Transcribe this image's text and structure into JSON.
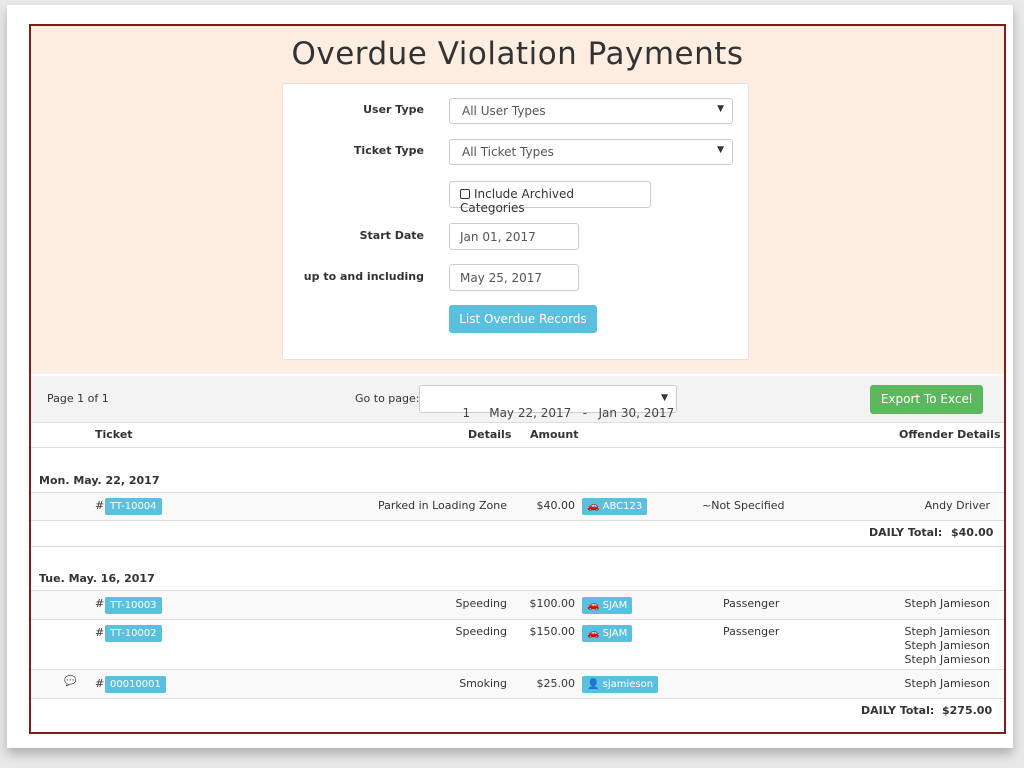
{
  "page": {
    "title": "Overdue Violation Payments"
  },
  "filters": {
    "user_type_label": "User Type",
    "user_type_value": "All User Types",
    "ticket_type_label": "Ticket Type",
    "ticket_type_value": "All Ticket Types",
    "archived_label": "Include Archived Categories",
    "start_date_label": "Start Date",
    "start_date_value": "Jan 01, 2017",
    "end_date_label": "up to and including",
    "end_date_value": "May 25, 2017",
    "submit_label": "List Overdue Records"
  },
  "pager": {
    "page_info": "Page 1 of 1",
    "goto_label": "Go to page:",
    "goto_value": "1     May 22, 2017   -   Jan 30, 2017",
    "export_label": "Export To Excel"
  },
  "columns": {
    "ticket": "Ticket",
    "details": "Details",
    "amount": "Amount",
    "offender": "Offender Details"
  },
  "groups": [
    {
      "date": "Mon. May. 22, 2017",
      "rows": [
        {
          "hash": "#",
          "ticket": "TT-10004",
          "details": "Parked in Loading Zone",
          "amount": "$40.00",
          "tag": "ABC123",
          "role": "~Not Specified",
          "offender": [
            "Andy Driver"
          ]
        }
      ],
      "total_label": "DAILY Total:",
      "total_value": "$40.00"
    },
    {
      "date": "Tue. May. 16, 2017",
      "rows": [
        {
          "hash": "#",
          "ticket": "TT-10003",
          "details": "Speeding",
          "amount": "$100.00",
          "tag": "SJAM",
          "role": "Passenger",
          "offender": [
            "Steph Jamieson"
          ]
        },
        {
          "hash": "#",
          "ticket": "TT-10002",
          "details": "Speeding",
          "amount": "$150.00",
          "tag": "SJAM",
          "role": "Passenger",
          "offender": [
            "Steph Jamieson",
            "Steph Jamieson",
            "Steph Jamieson"
          ]
        },
        {
          "hash": "#",
          "ticket": "00010001",
          "details": "Smoking",
          "amount": "$25.00",
          "tag": "sjamieson",
          "role": "",
          "offender": [
            "Steph Jamieson"
          ]
        }
      ],
      "total_label": "DAILY Total:",
      "total_value": "$275.00"
    }
  ],
  "icons": {
    "car": "car-icon",
    "user": "user-icon",
    "comment": "comment-icon"
  },
  "colors": {
    "accent_info": "#5bc0de",
    "accent_success": "#5cb85c",
    "frame_border": "#7b1e1e",
    "header_bg": "#fdeee1"
  }
}
